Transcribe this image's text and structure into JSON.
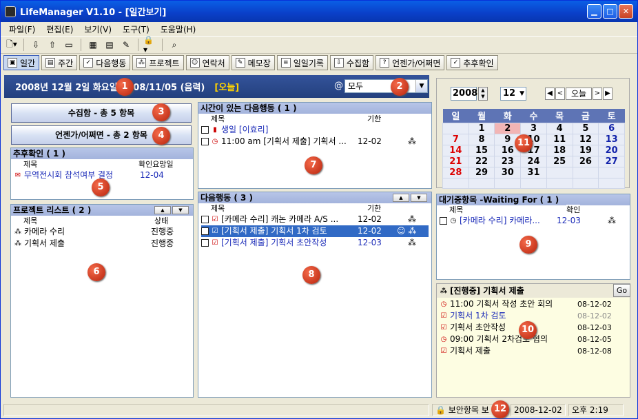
{
  "window": {
    "title": "LifeManager V1.10 - [일간보기]"
  },
  "menu": [
    "파일(F)",
    "편집(E)",
    "보기(V)",
    "도구(T)",
    "도움말(H)"
  ],
  "views": [
    {
      "label": "일간",
      "icon": "calendar-day-icon"
    },
    {
      "label": "주간",
      "icon": "calendar-week-icon"
    },
    {
      "label": "다음행동",
      "icon": "next-action-icon"
    },
    {
      "label": "프로젝트",
      "icon": "project-icon"
    },
    {
      "label": "연락처",
      "icon": "contact-icon"
    },
    {
      "label": "메모장",
      "icon": "memo-icon"
    },
    {
      "label": "일일기록",
      "icon": "journal-icon"
    },
    {
      "label": "수집함",
      "icon": "inbox-icon"
    },
    {
      "label": "언젠가/어쩌면",
      "icon": "someday-icon"
    },
    {
      "label": "추후확인",
      "icon": "followup-icon"
    }
  ],
  "datebar": {
    "date": "2008년 12월 2일 화요일",
    "lunar": "2008/11/05 (음력)",
    "today": "[오늘]",
    "at": "@",
    "filter": "모두"
  },
  "inbox_button": "수집함 - 총 5 항목",
  "someday_button": "언젠가/어쩌면 - 총 2 항목",
  "followup": {
    "header": "추후확인 ( 1 )",
    "cols": [
      "제목",
      "확인요망일"
    ],
    "rows": [
      {
        "title": "무역전시회 참석여부 결정",
        "date": "12-04"
      }
    ]
  },
  "projects": {
    "header": "프로젝트 리스트 ( 2 )",
    "cols": [
      "제목",
      "상태"
    ],
    "rows": [
      {
        "title": "카메라 수리",
        "status": "진행중"
      },
      {
        "title": "기획서 제출",
        "status": "진행중"
      }
    ]
  },
  "timed": {
    "header": "시간이 있는 다음행동 ( 1 )",
    "cols": [
      "제목",
      "기한"
    ],
    "rows": [
      {
        "title": "생일 [이효리]",
        "due": ""
      },
      {
        "title": "11:00 am [기획서 제출] 기획서 ...",
        "due": "12-02"
      }
    ]
  },
  "next": {
    "header": "다음행동 ( 3 )",
    "cols": [
      "제목",
      "기한"
    ],
    "rows": [
      {
        "title": "[카메라 수리] 캐논 카메라 A/S ...",
        "due": "12-02",
        "checked": false
      },
      {
        "title": "[기획서 제출] 기획서 1차 검토",
        "due": "12-02",
        "checked": true
      },
      {
        "title": "[기획서 제출] 기획서 초안작성",
        "due": "12-03",
        "checked": false
      }
    ]
  },
  "calendar": {
    "year": "2008",
    "month": "12",
    "today_btn": "오늘",
    "weekdays": [
      "일",
      "월",
      "화",
      "수",
      "목",
      "금",
      "토"
    ],
    "weeks": [
      [
        "",
        "1",
        "2",
        "3",
        "4",
        "5",
        "6"
      ],
      [
        "7",
        "8",
        "9",
        "10",
        "11",
        "12",
        "13"
      ],
      [
        "14",
        "15",
        "16",
        "17",
        "18",
        "19",
        "20"
      ],
      [
        "21",
        "22",
        "23",
        "24",
        "25",
        "26",
        "27"
      ],
      [
        "28",
        "29",
        "30",
        "31",
        "",
        "",
        ""
      ],
      [
        "",
        "",
        "",
        "",
        "",
        "",
        ""
      ]
    ]
  },
  "waiting": {
    "header": "대기중항목 -Waiting For ( 1 )",
    "cols": [
      "제목",
      "확인"
    ],
    "rows": [
      {
        "title": "[카메라 수리] 카메라...",
        "date": "12-03"
      }
    ]
  },
  "project_detail": {
    "header": "[진행중] 기획서 제출",
    "go": "Go",
    "rows": [
      {
        "title": "11:00 기획서 작성 초안 회의",
        "date": "08-12-02",
        "icon": "clock-icon",
        "gray": false,
        "blue": false
      },
      {
        "title": "기획서 1차 검토",
        "date": "08-12-02",
        "icon": "check-icon",
        "gray": true,
        "blue": true
      },
      {
        "title": "기획서 초안작성",
        "date": "08-12-03",
        "icon": "check-icon",
        "gray": false,
        "blue": false
      },
      {
        "title": "09:00 기획서 2차검토 협의",
        "date": "08-12-05",
        "icon": "clock-icon",
        "gray": false,
        "blue": false
      },
      {
        "title": "기획서 제출",
        "date": "08-12-08",
        "icon": "check-icon",
        "gray": false,
        "blue": false
      }
    ]
  },
  "status": {
    "secure": "보안항목 보",
    "date": "2008-12-02",
    "time": "오후 2:19"
  },
  "badges": [
    "1",
    "2",
    "3",
    "4",
    "5",
    "6",
    "7",
    "8",
    "9",
    "10",
    "11",
    "12"
  ]
}
